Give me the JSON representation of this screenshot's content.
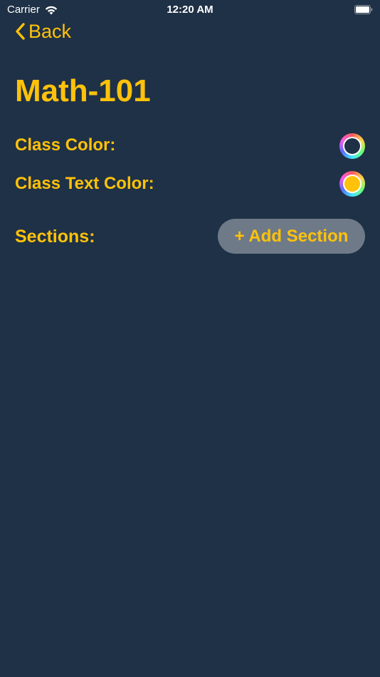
{
  "status_bar": {
    "carrier": "Carrier",
    "time": "12:20 AM"
  },
  "nav": {
    "back_label": "Back"
  },
  "page": {
    "title": "Math-101"
  },
  "class_color": {
    "label": "Class Color:",
    "value": "#1f3146"
  },
  "class_text_color": {
    "label": "Class Text Color:",
    "value": "#ffc20a"
  },
  "sections": {
    "label": "Sections:",
    "add_button_label": "+ Add Section"
  },
  "colors": {
    "background": "#1f3146",
    "accent": "#ffc20a",
    "button_bg": "#6e7a88"
  },
  "icons": {
    "back": "chevron-left-icon",
    "wifi": "wifi-icon",
    "battery": "battery-icon"
  }
}
